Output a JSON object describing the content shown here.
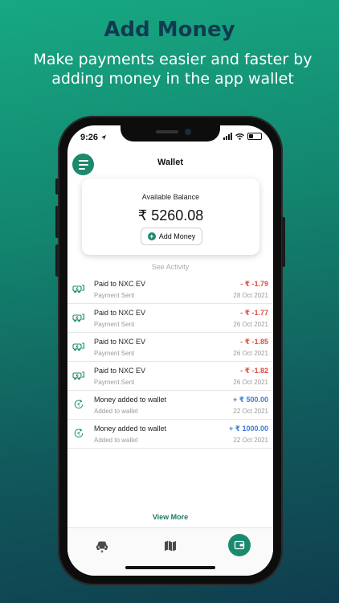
{
  "promo": {
    "title": "Add Money",
    "subtitle": "Make payments easier and faster by adding money in the app wallet"
  },
  "status_bar": {
    "time": "9:26"
  },
  "header": {
    "title": "Wallet",
    "menu_icon": "menu-icon"
  },
  "balance": {
    "label": "Available Balance",
    "amount": "₹ 5260.08",
    "add_button": "Add Money"
  },
  "see_activity": "See Activity",
  "activities": [
    {
      "icon": "charging-vehicle-icon",
      "title": "Paid to NXC EV",
      "subtitle": "Payment Sent",
      "amount": "- ₹ -1.79",
      "date": "28 Oct 2021",
      "kind": "neg"
    },
    {
      "icon": "charging-vehicle-icon",
      "title": "Paid to NXC EV",
      "subtitle": "Payment Sent",
      "amount": "- ₹ -1.77",
      "date": "26 Oct 2021",
      "kind": "neg"
    },
    {
      "icon": "charging-vehicle-icon",
      "title": "Paid to NXC EV",
      "subtitle": "Payment Sent",
      "amount": "- ₹ -1.85",
      "date": "26 Oct 2021",
      "kind": "neg"
    },
    {
      "icon": "charging-vehicle-icon",
      "title": "Paid to NXC EV",
      "subtitle": "Payment Sent",
      "amount": "- ₹ -1.82",
      "date": "26 Oct 2021",
      "kind": "neg"
    },
    {
      "icon": "rupee-cycle-icon",
      "title": "Money added to wallet",
      "subtitle": "Added to wallet",
      "amount": "+ ₹ 500.00",
      "date": "22 Oct 2021",
      "kind": "pos"
    },
    {
      "icon": "rupee-cycle-icon",
      "title": "Money added to wallet",
      "subtitle": "Added to wallet",
      "amount": "+ ₹ 1000.00",
      "date": "22 Oct 2021",
      "kind": "pos"
    }
  ],
  "view_more": "View More",
  "tabs": [
    {
      "icon": "car-icon",
      "active": false
    },
    {
      "icon": "map-icon",
      "active": false
    },
    {
      "icon": "wallet-icon",
      "active": true
    }
  ],
  "colors": {
    "accent": "#1a8a6e",
    "negative": "#e04a3f",
    "positive": "#3a7bd5",
    "promo_title": "#123a4f"
  }
}
